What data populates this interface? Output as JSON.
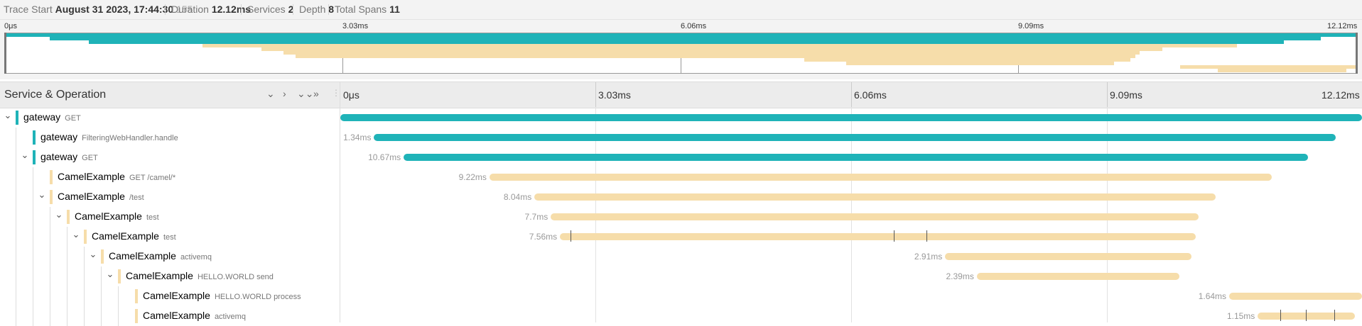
{
  "header": {
    "trace_start_label": "Trace Start",
    "trace_start_value": "August 31 2023, 17:44:30",
    "trace_start_ms": ".155",
    "duration_label": "Duration",
    "duration_value": "12.12ms",
    "services_label": "Services",
    "services_value": "2",
    "depth_label": "Depth",
    "depth_value": "8",
    "total_spans_label": "Total Spans",
    "total_spans_value": "11"
  },
  "minimap": {
    "ticks": [
      "0μs",
      "3.03ms",
      "6.06ms",
      "9.09ms",
      "12.12ms"
    ]
  },
  "timeline_header": {
    "title": "Service & Operation",
    "ticks": [
      "0μs",
      "3.03ms",
      "6.06ms",
      "9.09ms",
      "12.12ms"
    ]
  },
  "colors": {
    "gateway": "#1fb3b8",
    "camel": "#f6ddaa"
  },
  "spans": [
    {
      "service": "gateway",
      "operation": "GET",
      "depth": 0,
      "caret": true,
      "color": "#1fb3b8",
      "duration": "",
      "start": 0.0,
      "end": 1.0,
      "logs": []
    },
    {
      "service": "gateway",
      "operation": "FilteringWebHandler.handle",
      "depth": 1,
      "caret": false,
      "color": "#1fb3b8",
      "duration": "1.34ms",
      "start": 0.033,
      "end": 0.974,
      "logs": []
    },
    {
      "service": "gateway",
      "operation": "GET",
      "depth": 1,
      "caret": true,
      "color": "#1fb3b8",
      "duration": "10.67ms",
      "start": 0.062,
      "end": 0.947,
      "logs": []
    },
    {
      "service": "CamelExample",
      "operation": "GET /camel/*",
      "depth": 2,
      "caret": false,
      "color": "#f6ddaa",
      "duration": "9.22ms",
      "start": 0.146,
      "end": 0.912,
      "logs": []
    },
    {
      "service": "CamelExample",
      "operation": "/test",
      "depth": 2,
      "caret": true,
      "color": "#f6ddaa",
      "duration": "8.04ms",
      "start": 0.19,
      "end": 0.857,
      "logs": []
    },
    {
      "service": "CamelExample",
      "operation": "test",
      "depth": 3,
      "caret": true,
      "color": "#f6ddaa",
      "duration": "7.7ms",
      "start": 0.206,
      "end": 0.84,
      "logs": []
    },
    {
      "service": "CamelExample",
      "operation": "test",
      "depth": 4,
      "caret": true,
      "color": "#f6ddaa",
      "duration": "7.56ms",
      "start": 0.215,
      "end": 0.837,
      "logs": [
        0.225,
        0.542,
        0.574
      ]
    },
    {
      "service": "CamelExample",
      "operation": "activemq",
      "depth": 5,
      "caret": true,
      "color": "#f6ddaa",
      "duration": "2.91ms",
      "start": 0.592,
      "end": 0.833,
      "logs": []
    },
    {
      "service": "CamelExample",
      "operation": "HELLO.WORLD send",
      "depth": 6,
      "caret": true,
      "color": "#f6ddaa",
      "duration": "2.39ms",
      "start": 0.623,
      "end": 0.821,
      "logs": []
    },
    {
      "service": "CamelExample",
      "operation": "HELLO.WORLD process",
      "depth": 7,
      "caret": false,
      "color": "#f6ddaa",
      "duration": "1.64ms",
      "start": 0.87,
      "end": 1.005,
      "logs": []
    },
    {
      "service": "CamelExample",
      "operation": "activemq",
      "depth": 7,
      "caret": false,
      "color": "#f6ddaa",
      "duration": "1.15ms",
      "start": 0.898,
      "end": 0.993,
      "logs": [
        0.92,
        0.945,
        0.973
      ]
    }
  ]
}
